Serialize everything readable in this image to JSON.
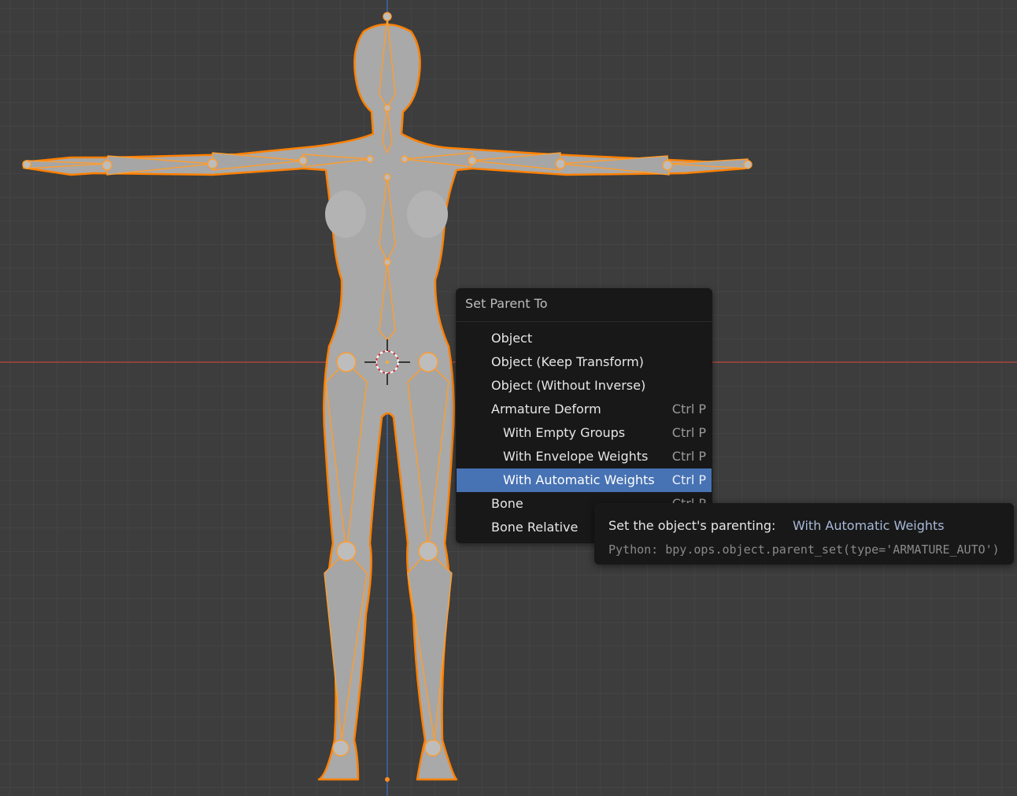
{
  "viewport": {
    "colors": {
      "background": "#3d3d3d",
      "grid": "#4a4a4a",
      "x_axis": "#c0453c",
      "z_axis": "#3d72c8",
      "selection_outline": "#ff8000",
      "mesh": "#a9a9a9"
    }
  },
  "menu": {
    "title": "Set Parent To",
    "items": [
      {
        "label": "Object",
        "shortcut": ""
      },
      {
        "label": "Object (Keep Transform)",
        "shortcut": ""
      },
      {
        "label": "Object (Without Inverse)",
        "shortcut": ""
      },
      {
        "label": "Armature Deform",
        "shortcut": "Ctrl P"
      },
      {
        "label": "With Empty Groups",
        "shortcut": "Ctrl P"
      },
      {
        "label": "With Envelope Weights",
        "shortcut": "Ctrl P"
      },
      {
        "label": "With Automatic Weights",
        "shortcut": "Ctrl P"
      },
      {
        "label": "Bone",
        "shortcut": "Ctrl P"
      },
      {
        "label": "Bone Relative",
        "shortcut": ""
      }
    ],
    "highlight_color": "#4772b3"
  },
  "tooltip": {
    "description": "Set the object's parenting:",
    "value": "With Automatic Weights",
    "python": "Python: bpy.ops.object.parent_set(type='ARMATURE_AUTO')"
  }
}
